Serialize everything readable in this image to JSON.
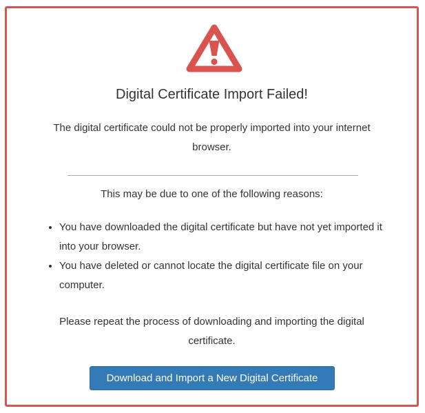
{
  "colors": {
    "frame_border": "#d9534f",
    "warning_icon": "#d9534f",
    "button_bg": "#337ab7",
    "button_text": "#ffffff",
    "text": "#333333"
  },
  "icon": {
    "name": "warning-triangle-icon"
  },
  "dialog": {
    "title": "Digital Certificate Import Failed!",
    "message": "The digital certificate could not be properly imported into your internet browser.",
    "reasons_intro": "This may be due to one of the following reasons:",
    "reasons": [
      "You have downloaded the digital certificate but have not yet imported it into your browser.",
      "You have deleted or cannot locate the digital certificate file on your computer."
    ],
    "repeat_message": "Please repeat the process of downloading and importing the digital certificate.",
    "button_label": "Download and Import a New Digital Certificate"
  }
}
